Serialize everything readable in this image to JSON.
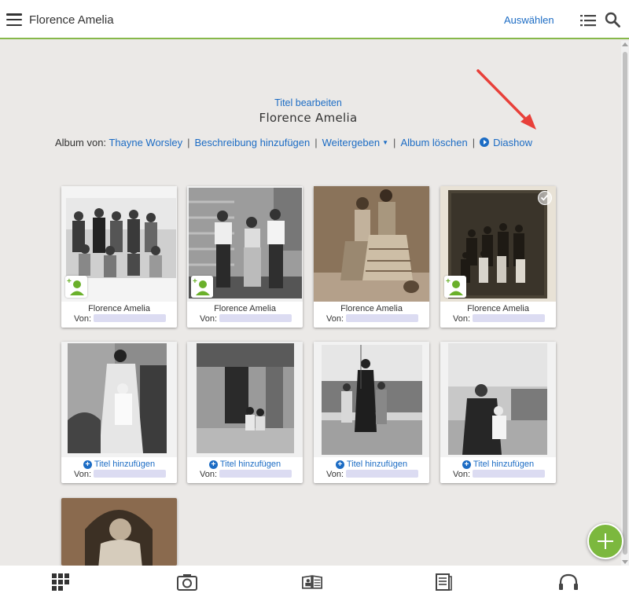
{
  "header": {
    "title": "Florence Amelia",
    "select_label": "Auswählen"
  },
  "album": {
    "edit_title_label": "Titel bearbeiten",
    "title": "Florence Amelia",
    "by_label": "Album von:",
    "owner": "Thayne Worsley",
    "add_description": "Beschreibung hinzufügen",
    "share": "Weitergeben",
    "delete": "Album löschen",
    "slideshow": "Diashow"
  },
  "photos": [
    {
      "caption": "Florence Amelia",
      "by_label": "Von:",
      "tag_badge": true,
      "selected": false
    },
    {
      "caption": "Florence Amelia",
      "by_label": "Von:",
      "tag_badge": true,
      "selected": false
    },
    {
      "caption": "Florence Amelia",
      "by_label": "Von:",
      "tag_badge": false,
      "selected": false
    },
    {
      "caption": "Florence Amelia",
      "by_label": "Von:",
      "tag_badge": true,
      "selected": true
    },
    {
      "caption": "Titel hinzufügen",
      "by_label": "Von:",
      "tag_badge": false,
      "selected": false
    },
    {
      "caption": "Titel hinzufügen",
      "by_label": "Von:",
      "tag_badge": false,
      "selected": false
    },
    {
      "caption": "Titel hinzufügen",
      "by_label": "Von:",
      "tag_badge": false,
      "selected": false
    },
    {
      "caption": "Titel hinzufügen",
      "by_label": "Von:",
      "tag_badge": false,
      "selected": false
    }
  ],
  "bottom_nav": [
    "grid-icon",
    "camera-icon",
    "book-icon",
    "document-icon",
    "headphones-icon"
  ],
  "colors": {
    "accent": "#1c6cc4",
    "brand_green": "#87b84a",
    "fab": "#7cb83e",
    "annotation_arrow": "#e8403a"
  }
}
